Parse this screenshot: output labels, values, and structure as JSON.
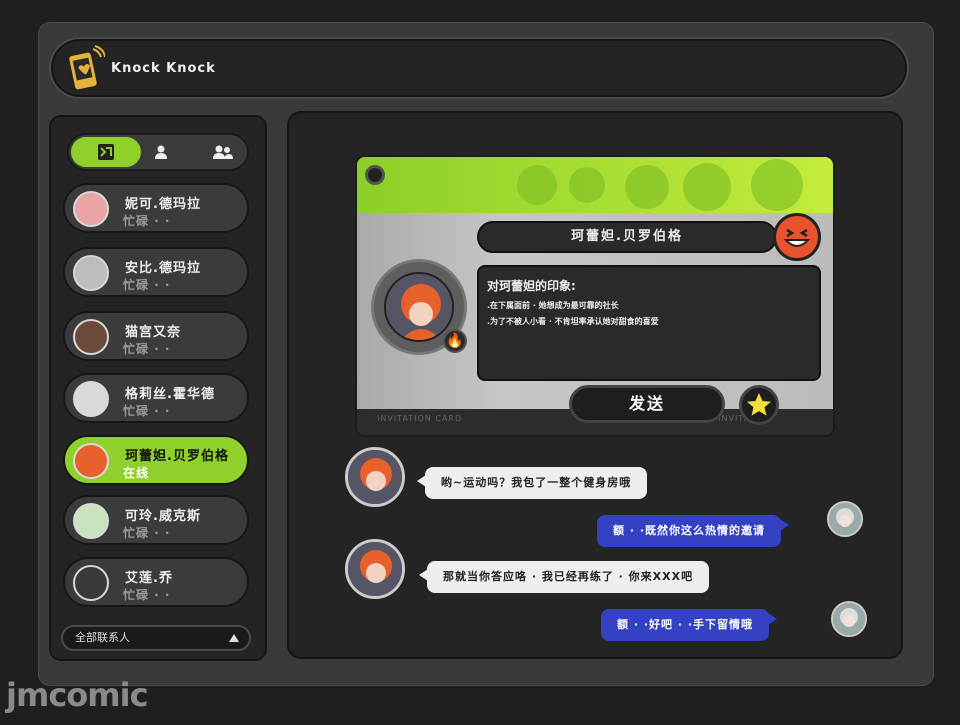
{
  "app": {
    "title": "Knock Knock"
  },
  "tabs": [
    {
      "name": "chat-tab",
      "icon": "chat-icon",
      "active": true
    },
    {
      "name": "friend-tab",
      "icon": "person-icon",
      "active": false
    },
    {
      "name": "group-tab",
      "icon": "group-icon",
      "active": false
    }
  ],
  "contacts": [
    {
      "name": "妮可.德玛拉",
      "status": "忙碌 · ·",
      "active": false,
      "color": "#e9a4a4"
    },
    {
      "name": "安比.德玛拉",
      "status": "忙碌 · ·",
      "active": false,
      "color": "#bdbdbd"
    },
    {
      "name": "猫宫又奈",
      "status": "忙碌 · ·",
      "active": false,
      "color": "#6b4a3a"
    },
    {
      "name": "格莉丝.霍华德",
      "status": "忙碌 · ·",
      "active": false,
      "color": "#d9d9d9"
    },
    {
      "name": "珂蕾妲.贝罗伯格",
      "status": "在线",
      "active": true,
      "color": "#e8612d"
    },
    {
      "name": "可玲.威克斯",
      "status": "忙碌 · ·",
      "active": false,
      "color": "#c9e3c0"
    },
    {
      "name": "艾莲.乔",
      "status": "忙碌 · ·",
      "active": false,
      "color": "#3a3a3a"
    }
  ],
  "all_contacts_label": "全部联系人",
  "card": {
    "name": "珂蕾妲.贝罗伯格",
    "impression_title": "对珂蕾妲的印象:",
    "impression_lines": [
      ".在下属面前 · 她想成为最可靠的社长",
      ".为了不被人小看 · 不肯坦率承认她对甜食的喜爱"
    ],
    "footer_left": "INVITATION CARD",
    "footer_right": "INVITATION",
    "send_label": "发送"
  },
  "messages": [
    {
      "side": "left",
      "text": "哟~运动吗？我包了一整个健身房哦"
    },
    {
      "side": "right",
      "text": "额 · ·既然你这么热情的邀请"
    },
    {
      "side": "left",
      "text": "那就当你答应咯 · 我已经再练了 · 你来XXX吧"
    },
    {
      "side": "right",
      "text": "额 · ·好吧 · ·手下留情哦"
    }
  ],
  "watermark": "jmcomic",
  "colors": {
    "accent_green": "#8fd12a",
    "bubble_blue": "#3541c4",
    "mood_orange": "#e8532d"
  }
}
